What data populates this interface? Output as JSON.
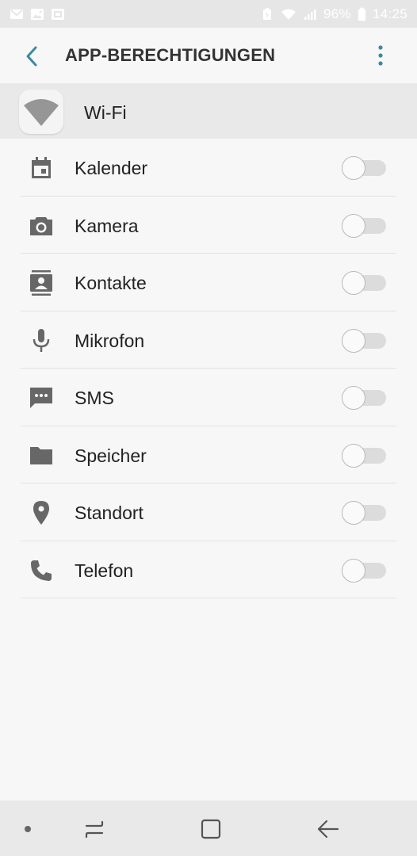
{
  "status_bar": {
    "battery": "96%",
    "time": "14:25",
    "icons": [
      "gmail-icon",
      "gallery-icon",
      "screenshot-icon",
      "battery-saver-icon",
      "wifi-icon",
      "signal-icon",
      "battery-icon"
    ]
  },
  "app_bar": {
    "title": "APP-BERECHTIGUNGEN",
    "back_icon": "chevron-left-icon",
    "more_icon": "more-vert-icon",
    "accent_color": "#3c8a9e"
  },
  "app": {
    "name": "Wi-Fi",
    "icon": "wifi-app-icon"
  },
  "permissions": [
    {
      "label": "Kalender",
      "icon": "calendar-icon",
      "enabled": false
    },
    {
      "label": "Kamera",
      "icon": "camera-icon",
      "enabled": false
    },
    {
      "label": "Kontakte",
      "icon": "contacts-icon",
      "enabled": false
    },
    {
      "label": "Mikrofon",
      "icon": "microphone-icon",
      "enabled": false
    },
    {
      "label": "SMS",
      "icon": "sms-icon",
      "enabled": false
    },
    {
      "label": "Speicher",
      "icon": "folder-icon",
      "enabled": false
    },
    {
      "label": "Standort",
      "icon": "location-icon",
      "enabled": false
    },
    {
      "label": "Telefon",
      "icon": "phone-icon",
      "enabled": false
    }
  ],
  "nav_bar": {
    "icons": [
      "nav-dot-icon",
      "recents-icon",
      "home-icon",
      "back-icon"
    ]
  }
}
